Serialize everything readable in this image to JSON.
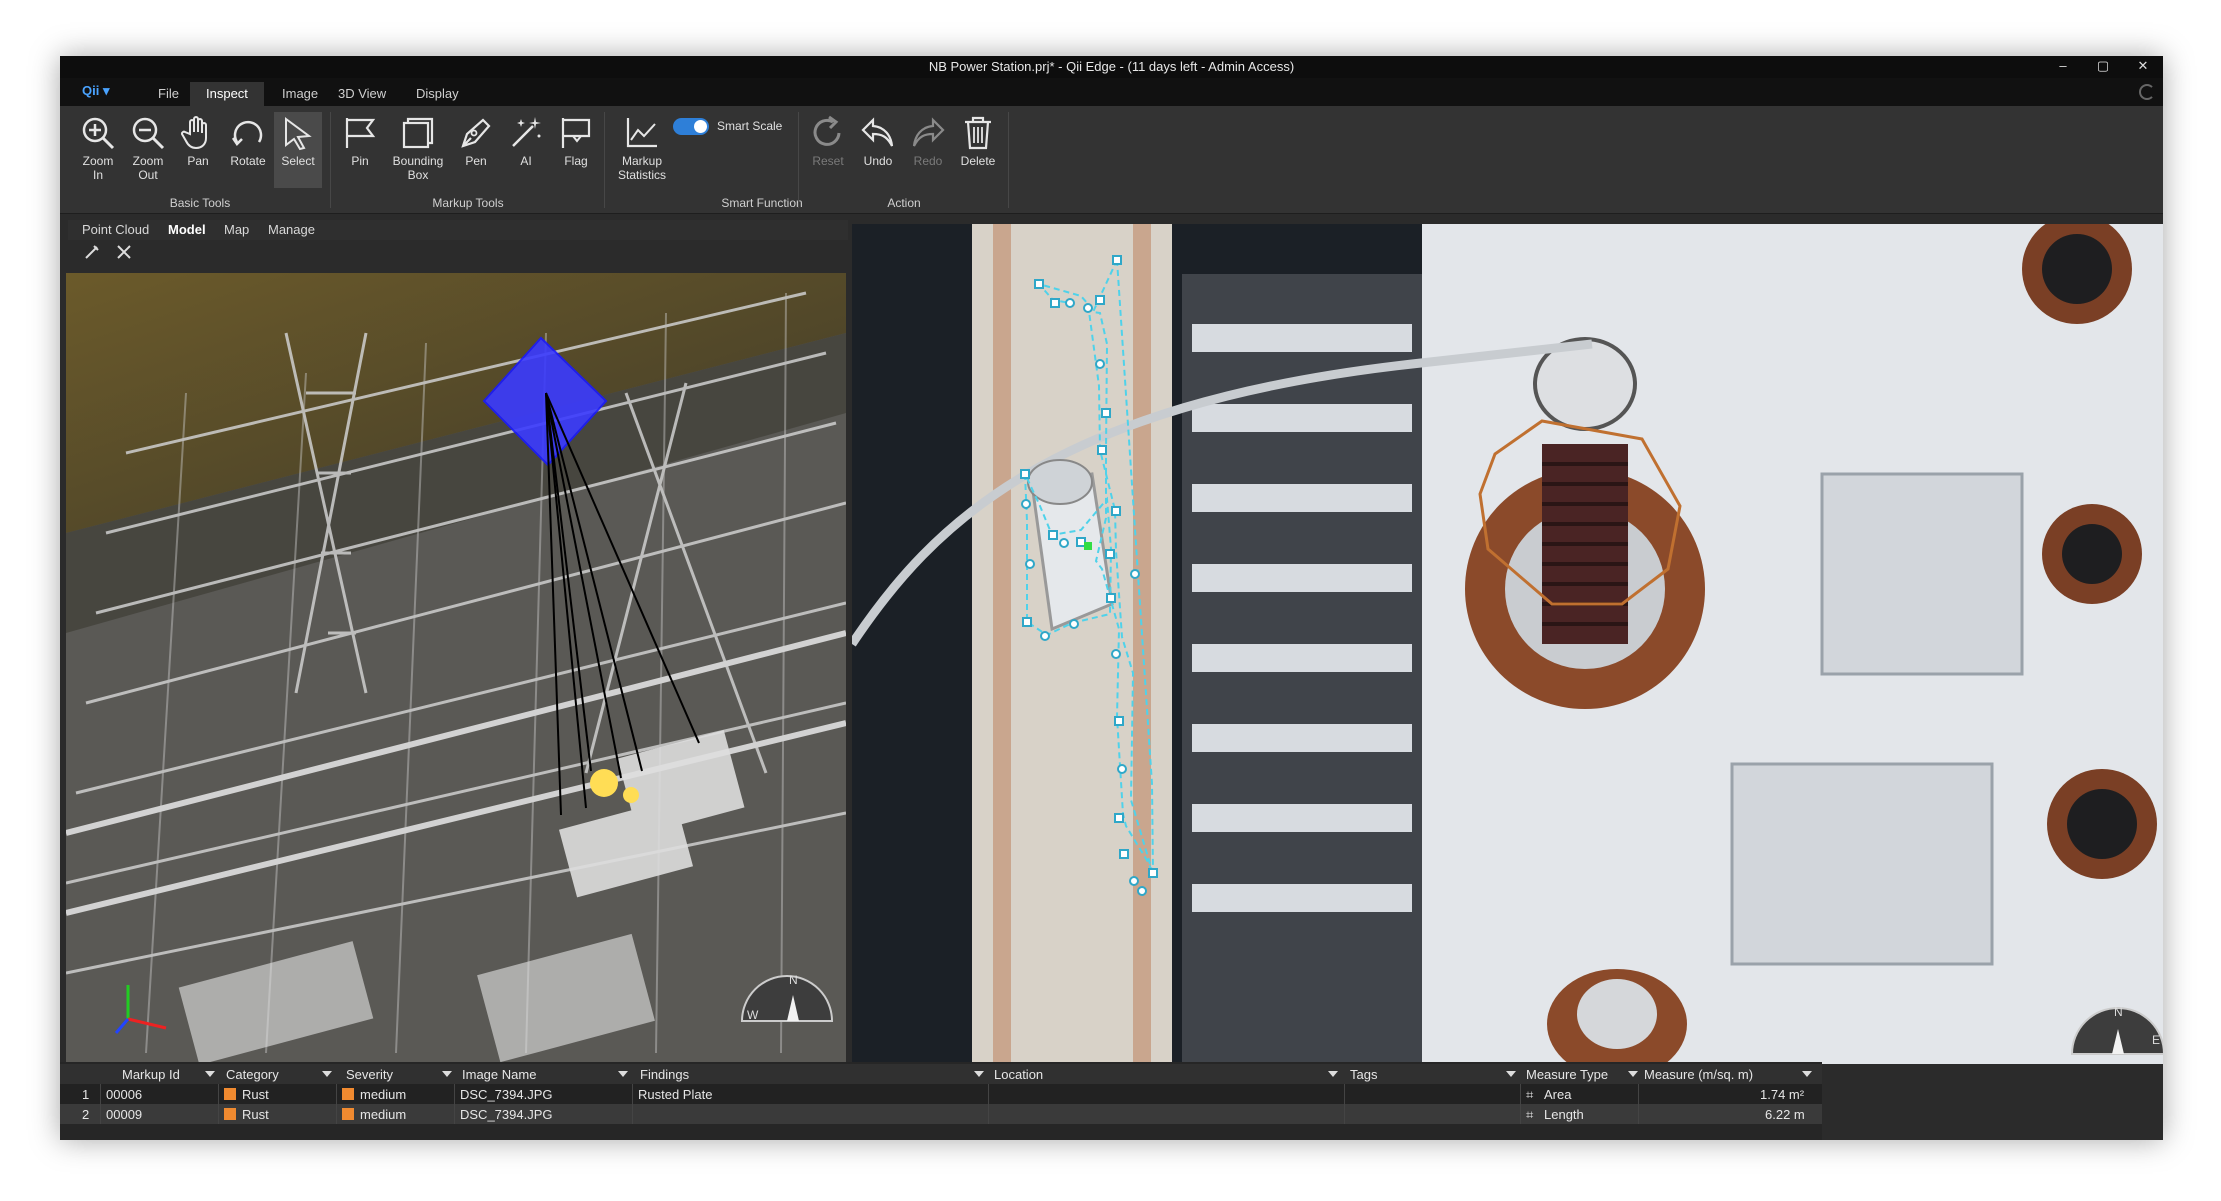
{
  "window": {
    "title": "NB Power Station.prj* - Qii Edge - (11 days left - Admin Access)",
    "controls": [
      "–",
      "▢",
      "✕"
    ]
  },
  "menu": {
    "logo": "Qii",
    "tabs": [
      "File",
      "Inspect",
      "Image",
      "3D View",
      "Display"
    ],
    "active": "Inspect"
  },
  "ribbon": {
    "basic_tools": {
      "label": "Basic Tools",
      "zoom_in": [
        "Zoom",
        "In"
      ],
      "zoom_out": [
        "Zoom",
        "Out"
      ],
      "pan": "Pan",
      "rotate": "Rotate",
      "select": "Select"
    },
    "markup_tools": {
      "label": "Markup Tools",
      "pin": "Pin",
      "bounding_box": [
        "Bounding",
        "Box"
      ],
      "pen": "Pen",
      "ai": "AI",
      "flag": "Flag"
    },
    "smart_function": {
      "label": "Smart Function",
      "markup_statistics": [
        "Markup",
        "Statistics"
      ],
      "smart_scale": "Smart Scale"
    },
    "action": {
      "label": "Action",
      "reset": "Reset",
      "undo": "Undo",
      "redo": "Redo",
      "delete": "Delete"
    }
  },
  "left_panel": {
    "tabs": [
      "Point Cloud",
      "Model",
      "Map",
      "Manage"
    ],
    "active": "Model",
    "compass": "N",
    "compass_side": "W"
  },
  "right_panel": {
    "compass": "N",
    "compass_side": "E"
  },
  "table": {
    "columns": [
      "Markup Id",
      "Category",
      "Severity",
      "Image Name",
      "Findings",
      "Location",
      "Tags",
      "Measure Type",
      "Measure (m/sq. m)"
    ],
    "rows": [
      {
        "index": "1",
        "markup_id": "00006",
        "category": "Rust",
        "severity": "medium",
        "image_name": "DSC_7394.JPG",
        "findings": "Rusted Plate",
        "location": "",
        "tags": "",
        "measure_type": "Area",
        "measure": "1.74 m²"
      },
      {
        "index": "2",
        "markup_id": "00009",
        "category": "Rust",
        "severity": "medium",
        "image_name": "DSC_7394.JPG",
        "findings": "",
        "location": "",
        "tags": "",
        "measure_type": "Length",
        "measure": "6.22 m"
      }
    ]
  },
  "colors": {
    "accent": "#2e7fd8",
    "rust_swatch": "#f08a30",
    "markup_line": "#4fd2ea",
    "area_outline": "#c07030",
    "pyramid": "#3b3bff"
  }
}
